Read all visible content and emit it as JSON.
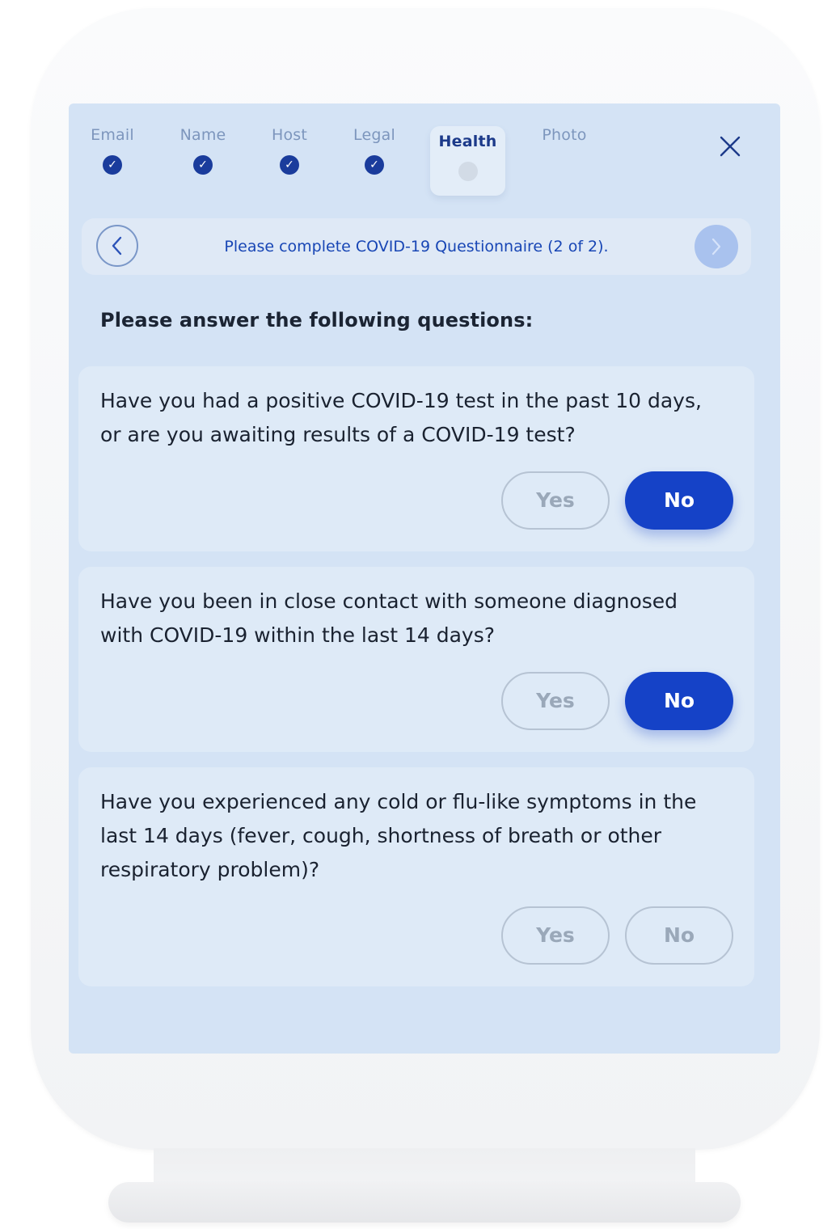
{
  "steps": [
    {
      "label": "Email",
      "done": true
    },
    {
      "label": "Name",
      "done": true
    },
    {
      "label": "Host",
      "done": true
    },
    {
      "label": "Legal",
      "done": true
    },
    {
      "label": "Health",
      "done": false,
      "active": true
    },
    {
      "label": "Photo",
      "done": false
    }
  ],
  "icons": {
    "check": "check-icon",
    "close": "close-icon",
    "back": "chevron-left-icon",
    "next": "chevron-right-icon"
  },
  "banner": {
    "text": "Please complete COVID-19 Questionnaire (2 of 2)."
  },
  "section": {
    "heading": "Please answer the following questions:"
  },
  "questions": [
    {
      "text": "Have you had a positive COVID-19 test in the past 10 days, or are you awaiting results of a COVID-19 test?",
      "yes_label": "Yes",
      "no_label": "No",
      "selected": "No"
    },
    {
      "text": "Have you been in close contact with someone diagnosed with COVID-19 within the last 14 days?",
      "yes_label": "Yes",
      "no_label": "No",
      "selected": "No"
    },
    {
      "text": "Have you experienced any cold or flu-like symptoms in the last 14 days (fever, cough, shortness of breath or other respiratory problem)?",
      "yes_label": "Yes",
      "no_label": "No",
      "selected": null
    }
  ],
  "colors": {
    "accent": "#1542c7",
    "step_done": "#1a3c9c",
    "screen_bg": "#d4e3f5"
  }
}
